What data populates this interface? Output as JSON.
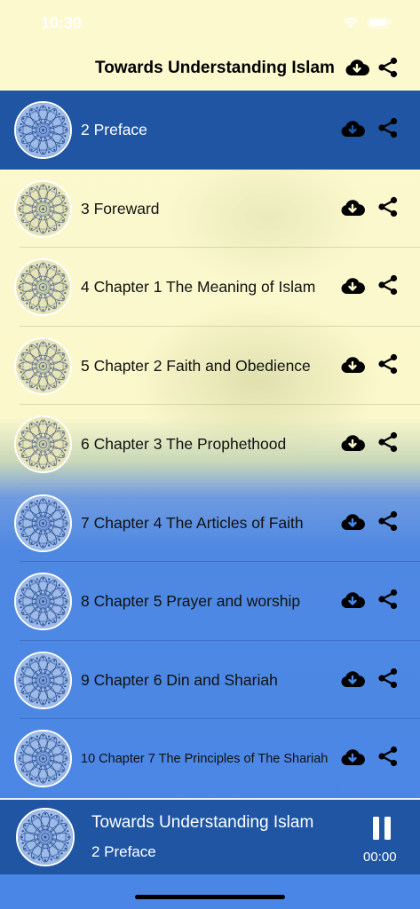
{
  "status_bar": {
    "time": "10:30"
  },
  "header": {
    "title": "Towards Understanding Islam"
  },
  "colors": {
    "accent": "#1f55a3",
    "cream": "#fdf9cf",
    "blue": "#4a86e6"
  },
  "tracks": [
    {
      "title": "2 Preface",
      "active": true,
      "theme": "blue"
    },
    {
      "title": "3 Foreward",
      "active": false,
      "theme": "cream"
    },
    {
      "title": "4 Chapter 1 The Meaning of Islam",
      "active": false,
      "theme": "cream"
    },
    {
      "title": "5 Chapter 2 Faith and Obedience",
      "active": false,
      "theme": "cream"
    },
    {
      "title": "6 Chapter 3 The Prophethood",
      "active": false,
      "theme": "cream"
    },
    {
      "title": "7 Chapter 4 The Articles of Faith",
      "active": false,
      "theme": "blue"
    },
    {
      "title": "8 Chapter 5 Prayer and worship",
      "active": false,
      "theme": "blue"
    },
    {
      "title": "9 Chapter 6 Din and Shariah",
      "active": false,
      "theme": "blue"
    },
    {
      "title": "10 Chapter 7 The Principles of The Shariah",
      "active": false,
      "theme": "blue"
    }
  ],
  "player": {
    "title": "Towards Understanding Islam",
    "subtitle": "2 Preface",
    "time": "00:00",
    "state": "playing"
  }
}
